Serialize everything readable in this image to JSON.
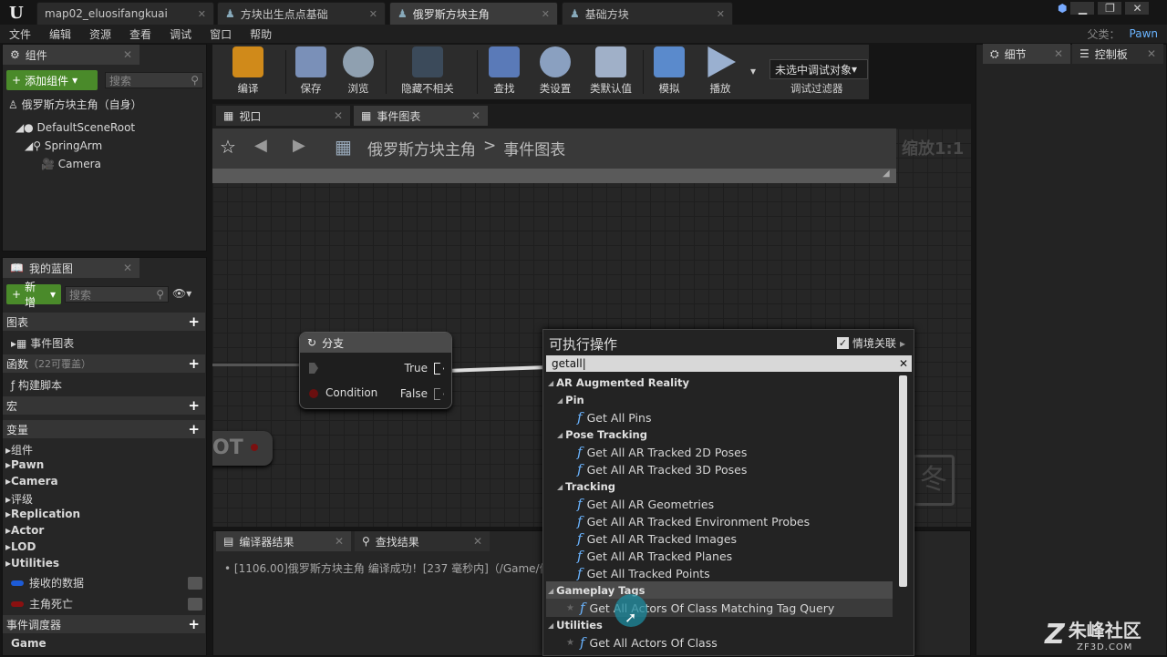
{
  "tabs": [
    {
      "label": "map02_eluosifangkuai"
    },
    {
      "label": "方块出生点点基础"
    },
    {
      "label": "俄罗斯方块主角"
    },
    {
      "label": "基础方块"
    }
  ],
  "menu": [
    "文件",
    "编辑",
    "资源",
    "查看",
    "调试",
    "窗口",
    "帮助"
  ],
  "parent": {
    "label": "父类：",
    "value": "Pawn"
  },
  "components": {
    "tab": "组件",
    "add": "添加组件",
    "search_placeholder": "搜索",
    "self": "俄罗斯方块主角（自身）",
    "tree": [
      "DefaultSceneRoot",
      "SpringArm",
      "Camera"
    ]
  },
  "mybp": {
    "tab": "我的蓝图",
    "new": "新增",
    "search_placeholder": "搜索",
    "graphs": "图表",
    "event_graph": "事件图表",
    "functions": "函数",
    "functions_note": "（22可覆盖）",
    "construct": "构建脚本",
    "macros": "宏",
    "variables": "变量",
    "var_groups": [
      "组件",
      "Pawn",
      "Camera",
      "评级",
      "Replication",
      "Actor",
      "LOD",
      "Utilities"
    ],
    "vars": [
      "接收的数据",
      "主角死亡"
    ],
    "dispatchers": "事件调度器",
    "game": "Game"
  },
  "toolbar": [
    "编译",
    "保存",
    "浏览",
    "隐藏不相关",
    "查找",
    "类设置",
    "类默认值",
    "模拟",
    "播放"
  ],
  "debug": {
    "target": "未选中调试对象",
    "filter": "调试过滤器"
  },
  "right_tabs": [
    "细节",
    "控制板"
  ],
  "view_tabs": [
    "视口",
    "事件图表"
  ],
  "breadcrumb": {
    "root": "俄罗斯方块主角",
    "sep": ">",
    "leaf": "事件图表"
  },
  "zoom": "缩放1:1",
  "node": {
    "title": "分支",
    "true": "True",
    "condition": "Condition",
    "false": "False"
  },
  "node_fragment": "OT",
  "bottom": {
    "tabs": [
      "编译器结果",
      "查找结果"
    ],
    "log": "[1106.00]俄罗斯方块主角 编译成功！[237 毫秒内]（/Game/俄"
  },
  "actions": {
    "title": "可执行操作",
    "context": "情境关联",
    "query": "getall",
    "rows": [
      {
        "t": "cat",
        "level": 0,
        "text": "AR Augmented Reality"
      },
      {
        "t": "cat",
        "level": 1,
        "text": "Pin"
      },
      {
        "t": "item",
        "level": 2,
        "text": "Get All Pins"
      },
      {
        "t": "cat",
        "level": 1,
        "text": "Pose Tracking"
      },
      {
        "t": "item",
        "level": 2,
        "text": "Get All AR Tracked 2D Poses"
      },
      {
        "t": "item",
        "level": 2,
        "text": "Get All AR Tracked 3D Poses"
      },
      {
        "t": "cat",
        "level": 1,
        "text": "Tracking"
      },
      {
        "t": "item",
        "level": 2,
        "text": "Get All AR Geometries"
      },
      {
        "t": "item",
        "level": 2,
        "text": "Get All AR Tracked Environment Probes"
      },
      {
        "t": "item",
        "level": 2,
        "text": "Get All AR Tracked Images"
      },
      {
        "t": "item",
        "level": 2,
        "text": "Get All AR Tracked Planes"
      },
      {
        "t": "item",
        "level": 2,
        "text": "Get All Tracked Points"
      },
      {
        "t": "cat",
        "level": 0,
        "text": "Gameplay Tags",
        "hl": true
      },
      {
        "t": "item",
        "level": 1,
        "text": "Get All Actors Of Class Matching Tag Query",
        "hl": true
      },
      {
        "t": "cat",
        "level": 0,
        "text": "Utilities"
      },
      {
        "t": "item",
        "level": 1,
        "text": "Get All Actors Of Class"
      }
    ]
  },
  "watermark": {
    "name": "朱峰社区",
    "url": "ZF3D.COM"
  }
}
